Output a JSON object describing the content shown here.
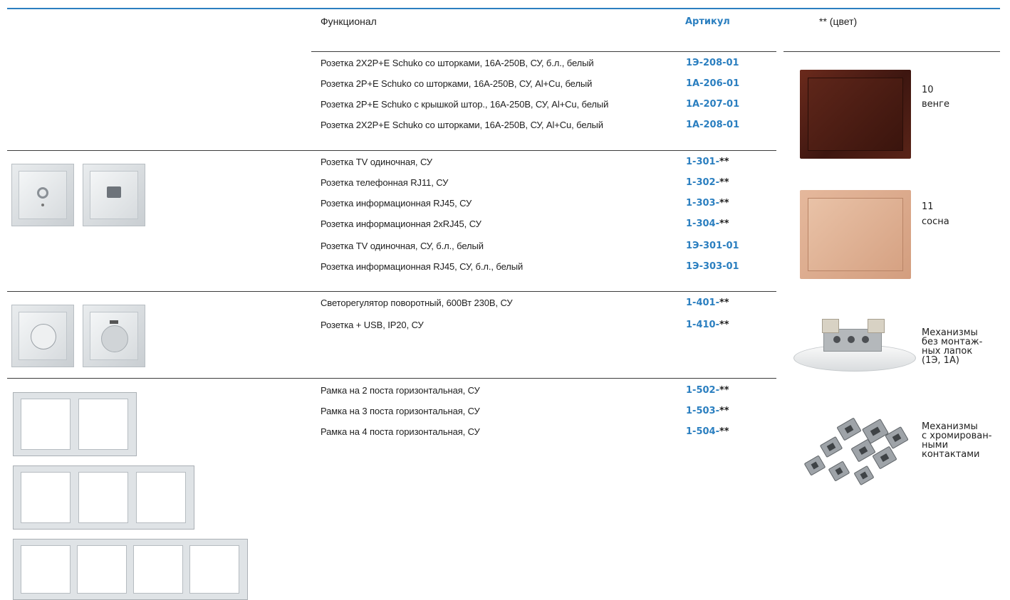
{
  "header": {
    "functional": "Функционал",
    "article": "Артикул",
    "color": "** (цвет)"
  },
  "groups": [
    {
      "rows": [
        {
          "name": "Розетка 2Х2Р+Е Schuko со шторками, 16А-250В, СУ, б.л., белый",
          "art_main": "1Э-208-01",
          "art_suffix": ""
        },
        {
          "name": "Розетка 2P+E Schuko со шторками, 16А-250В, СУ, Al+Cu, белый",
          "art_main": "1А-206-01",
          "art_suffix": ""
        },
        {
          "name": "Розетка 2P+E Schuko с крышкой штор., 16А-250В, СУ, Al+Cu, белый",
          "art_main": "1А-207-01",
          "art_suffix": ""
        },
        {
          "name": "Розетка 2Х2Р+Е Schuko со шторками, 16А-250В, СУ, Al+Cu, белый",
          "art_main": "1А-208-01",
          "art_suffix": ""
        }
      ]
    },
    {
      "rows": [
        {
          "name": "Розетка TV одиночная, СУ",
          "art_main": "1-301-",
          "art_suffix": "**"
        },
        {
          "name": "Розетка телефонная RJ11, СУ",
          "art_main": "1-302-",
          "art_suffix": "**"
        },
        {
          "name": "Розетка информационная RJ45, СУ",
          "art_main": "1-303-",
          "art_suffix": "**"
        },
        {
          "name": "Розетка информационная 2хRJ45, СУ",
          "art_main": "1-304-",
          "art_suffix": "**"
        },
        {
          "name": "Розетка TV одиночная, СУ, б.л., белый",
          "art_main": "1Э-301-01",
          "art_suffix": ""
        },
        {
          "name": "Розетка информационная RJ45, СУ, б.л., белый",
          "art_main": "1Э-303-01",
          "art_suffix": ""
        }
      ]
    },
    {
      "rows": [
        {
          "name": "Светорегулятор поворотный, 600Вт 230В, СУ",
          "art_main": "1-401-",
          "art_suffix": "**"
        },
        {
          "name": "Розетка + USB, IP20, СУ",
          "art_main": "1-410-",
          "art_suffix": "**"
        }
      ]
    },
    {
      "rows": [
        {
          "name": "Рамка на 2 поста горизонтальная, СУ",
          "art_main": "1-502-",
          "art_suffix": "**"
        },
        {
          "name": "Рамка на 3 поста горизонтальная, СУ",
          "art_main": "1-503-",
          "art_suffix": "**"
        },
        {
          "name": "Рамка на 4 поста горизонтальная, СУ",
          "art_main": "1-504-",
          "art_suffix": "**"
        }
      ]
    }
  ],
  "colors": [
    {
      "code": "10",
      "name": "венге",
      "swatch": "#4a1b12"
    },
    {
      "code": "11",
      "name": "сосна",
      "swatch": "#dba98b"
    }
  ],
  "mechanisms": [
    {
      "caption": "Механизмы\nбез монтаж-\nных лапок\n(1Э, 1А)"
    },
    {
      "caption": "Механизмы\nс хромирован-\nными\nконтактами"
    }
  ],
  "style": {
    "accent": "#2b7fc0",
    "text": "#1e1e1e"
  }
}
